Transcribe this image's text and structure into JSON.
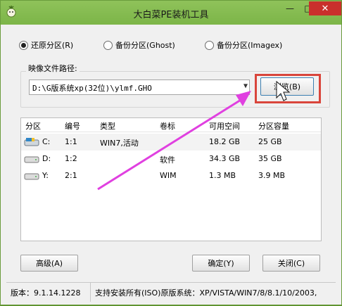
{
  "window": {
    "title": "大白菜PE装机工具",
    "min_glyph": "—",
    "max_glyph": "□",
    "close_glyph": "✕"
  },
  "options": [
    {
      "label": "还原分区(R)",
      "selected": true
    },
    {
      "label": "备份分区(Ghost)",
      "selected": false
    },
    {
      "label": "备份分区(Imagex)",
      "selected": false
    }
  ],
  "image_path": {
    "label": "映像文件路径:",
    "value": "D:\\G版系统xp(32位)\\ylmf.GHO",
    "browse_label": "浏览(B)"
  },
  "table": {
    "headers": [
      "分区",
      "编号",
      "类型",
      "卷标",
      "可用空间",
      "分区容量"
    ],
    "rows": [
      {
        "drive": "C:",
        "num": "1:1",
        "type": "WIN7,活动",
        "label": "",
        "free": "18.2 GB",
        "size": "25 GB"
      },
      {
        "drive": "D:",
        "num": "1:2",
        "type": "",
        "label": "软件",
        "free": "34.3 GB",
        "size": "35 GB"
      },
      {
        "drive": "Y:",
        "num": "2:1",
        "type": "",
        "label": "WIM",
        "free": "1.3 MB",
        "size": "3.9 MB"
      }
    ]
  },
  "buttons": {
    "advanced": "高级(A)",
    "ok": "确定(Y)",
    "close": "关闭(C)"
  },
  "status": {
    "version": "版本：9.1.14.1228",
    "support": "支持安装所有(ISO)原版系统：XP/VISTA/WIN7/8/8.1/10/2003,"
  },
  "colors": {
    "titlebar": "#7cb548",
    "highlight": "#d9453b",
    "arrow": "#e040e0"
  }
}
